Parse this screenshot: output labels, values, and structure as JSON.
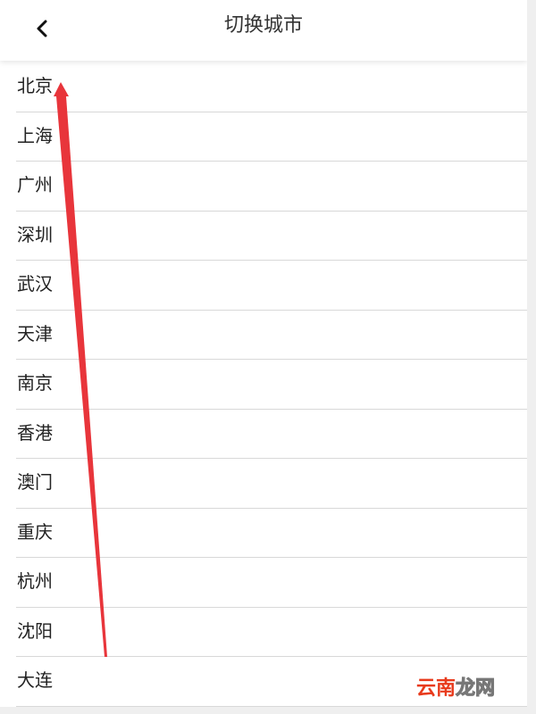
{
  "header": {
    "title": "切换城市",
    "back_icon": "chevron-left-icon"
  },
  "cities": [
    "北京",
    "上海",
    "广州",
    "深圳",
    "武汉",
    "天津",
    "南京",
    "香港",
    "澳门",
    "重庆",
    "杭州",
    "沈阳",
    "大连"
  ],
  "annotation": {
    "arrow_color": "#e8353b"
  },
  "watermark": {
    "text_a": "云南",
    "text_b": "龙网",
    "color_a": "#e83a1c"
  }
}
